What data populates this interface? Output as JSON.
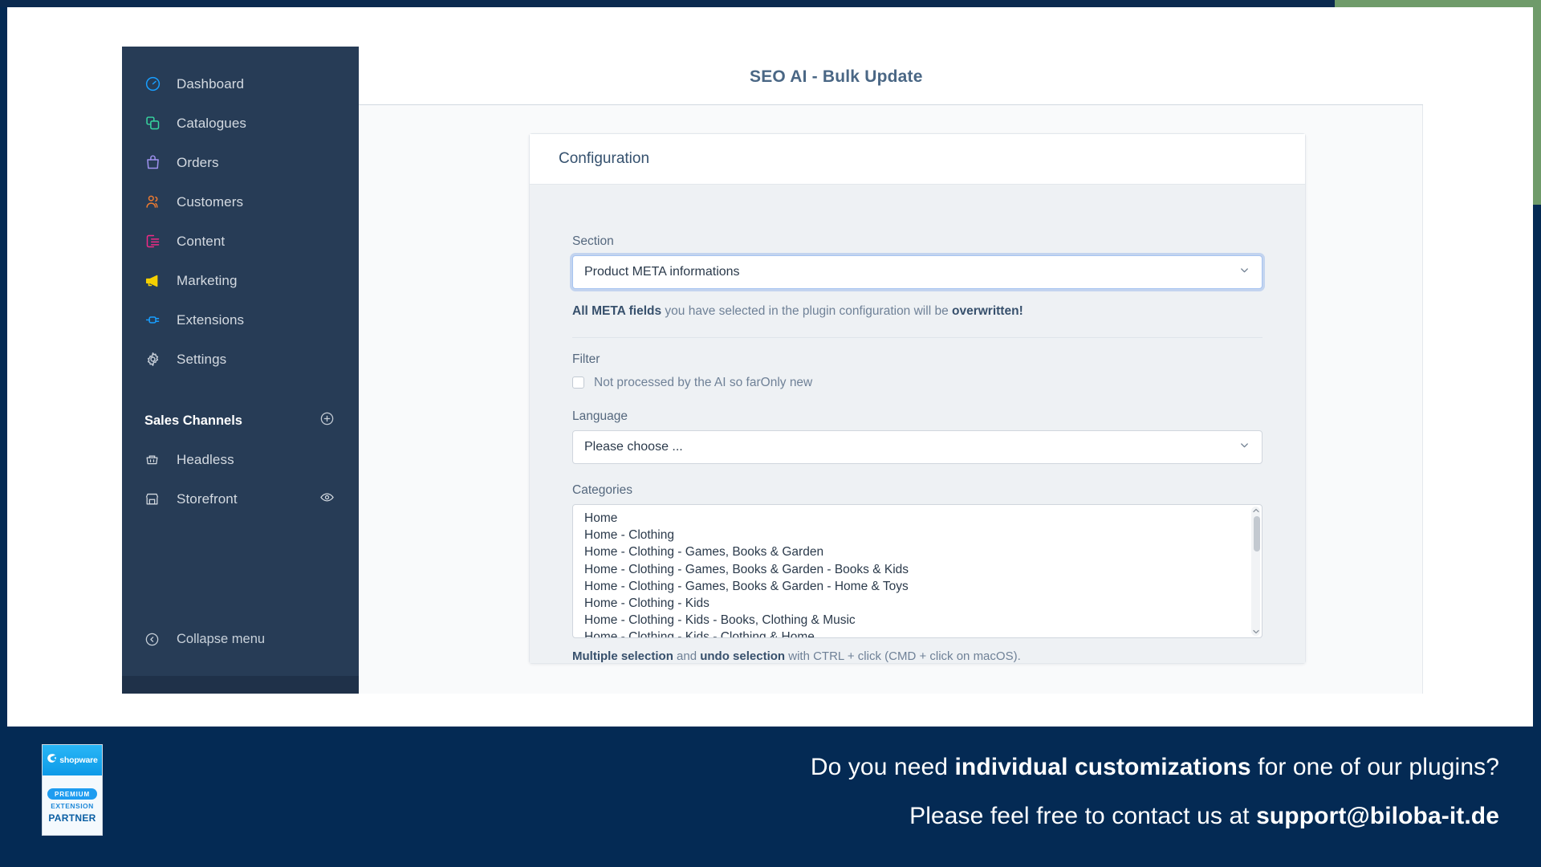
{
  "window": {
    "page_title": "SEO AI - Bulk Update"
  },
  "sidebar": {
    "items": [
      {
        "label": "Dashboard",
        "icon": "dashboard-gauge-icon",
        "color": "#189eff"
      },
      {
        "label": "Catalogues",
        "icon": "catalogues-copy-icon",
        "color": "#37d7a0"
      },
      {
        "label": "Orders",
        "icon": "orders-bag-icon",
        "color": "#a092f0"
      },
      {
        "label": "Customers",
        "icon": "customers-people-icon",
        "color": "#ee7b30"
      },
      {
        "label": "Content",
        "icon": "content-layout-icon",
        "color": "#ef2a85"
      },
      {
        "label": "Marketing",
        "icon": "marketing-megaphone-icon",
        "color": "#f5d000"
      },
      {
        "label": "Extensions",
        "icon": "extensions-plug-icon",
        "color": "#189eff"
      },
      {
        "label": "Settings",
        "icon": "settings-gear-icon",
        "color": "#c3cbd5"
      }
    ],
    "sales_channels": {
      "title": "Sales Channels",
      "add_icon": "plus-circle-icon",
      "items": [
        {
          "label": "Headless",
          "icon": "basket-icon",
          "trailing_icon": ""
        },
        {
          "label": "Storefront",
          "icon": "storefront-icon",
          "trailing_icon": "eye-icon"
        }
      ]
    },
    "collapse": {
      "label": "Collapse menu",
      "icon": "chevron-left-circle-icon"
    }
  },
  "config_card": {
    "title": "Configuration",
    "section": {
      "label": "Section",
      "value": "Product META informations",
      "chevron_icon": "chevron-down-icon"
    },
    "section_hint": {
      "bold_1": "All META fields",
      "middle": " you have selected in the plugin configuration will be ",
      "bold_2": "overwritten",
      "tail": "!"
    },
    "filter": {
      "label": "Filter",
      "checkbox_label": "Not processed by the AI so farOnly new",
      "checked": false
    },
    "language": {
      "label": "Language",
      "value": "Please choose ...",
      "chevron_icon": "chevron-down-icon"
    },
    "categories": {
      "label": "Categories",
      "options": [
        "Home",
        "Home - Clothing",
        "Home - Clothing - Games, Books & Garden",
        "Home - Clothing - Games, Books & Garden - Books & Kids",
        "Home - Clothing - Games, Books & Garden - Home & Toys",
        "Home - Clothing - Kids",
        "Home - Clothing - Kids - Books, Clothing & Music",
        "Home - Clothing - Kids - Clothing & Home"
      ],
      "scroll_up_icon": "caret-up-icon",
      "scroll_down_icon": "caret-down-icon"
    },
    "multi_hint": {
      "bold_1": "Multiple selection",
      "middle": " and ",
      "bold_2": "undo selection",
      "tail": " with CTRL + click (CMD + click on macOS)."
    }
  },
  "banner": {
    "badge": {
      "brand": "shopware",
      "logo_icon": "shopware-logo-icon",
      "premium": "PREMIUM",
      "extension": "EXTENSION",
      "partner": "PARTNER"
    },
    "line1": {
      "pre": "Do you need ",
      "bold": "individual customizations",
      "post": " for one of our plugins?"
    },
    "line2": {
      "pre": "Please feel free to contact us at ",
      "bold": "support@biloba-it.de",
      "post": ""
    }
  },
  "colors": {
    "banner_bg": "#042a54",
    "sidebar_bg": "#273c56",
    "accent_green": "#6f9b6a",
    "focus_blue": "#a7c4f0",
    "title_blue": "#4a6785"
  }
}
